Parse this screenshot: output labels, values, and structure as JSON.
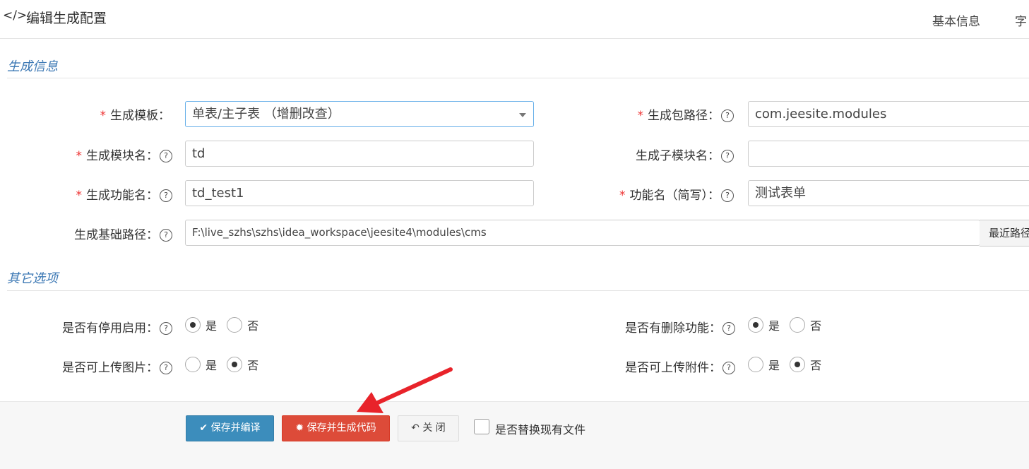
{
  "header": {
    "code_icon": "</>",
    "title": "编辑生成配置",
    "tabs": [
      {
        "label": "基本信息"
      },
      {
        "label": "字"
      }
    ]
  },
  "sections": {
    "gen_info": "生成信息",
    "other_options": "其它选项"
  },
  "form": {
    "template": {
      "label": "生成模板：",
      "value": "单表/主子表 （增删改查）"
    },
    "package_path": {
      "label": "生成包路径：",
      "value": "com.jeesite.modules"
    },
    "module_name": {
      "label": "生成模块名：",
      "value": "td"
    },
    "sub_module_name": {
      "label": "生成子模块名：",
      "value": ""
    },
    "function_name": {
      "label": "生成功能名：",
      "value": "td_test1"
    },
    "function_name_simple": {
      "label": "功能名（简写）：",
      "value": "测试表单"
    },
    "base_path": {
      "label": "生成基础路径：",
      "value": "F:\\live_szhs\\szhs\\idea_workspace\\jeesite4\\modules\\cms",
      "addon": "最近路径"
    }
  },
  "required_mark": "*",
  "help_mark": "?",
  "options": {
    "yes": "是",
    "no": "否",
    "disable_enable": {
      "label": "是否有停用启用：",
      "selected": "是"
    },
    "delete_function": {
      "label": "是否有删除功能：",
      "selected": "是"
    },
    "upload_image": {
      "label": "是否可上传图片：",
      "selected": "否"
    },
    "upload_attachment": {
      "label": "是否可上传附件：",
      "selected": "否"
    }
  },
  "footer": {
    "save_compile": "保存并编译",
    "save_generate": "保存并生成代码",
    "close": "关 闭",
    "replace_files": "是否替换现有文件",
    "replace_checked": false
  },
  "colors": {
    "primary": "#3c8dbc",
    "danger": "#dd4b39",
    "section_title": "#3c78b4",
    "required": "#ee3333",
    "annotation_arrow": "#e8232a"
  }
}
